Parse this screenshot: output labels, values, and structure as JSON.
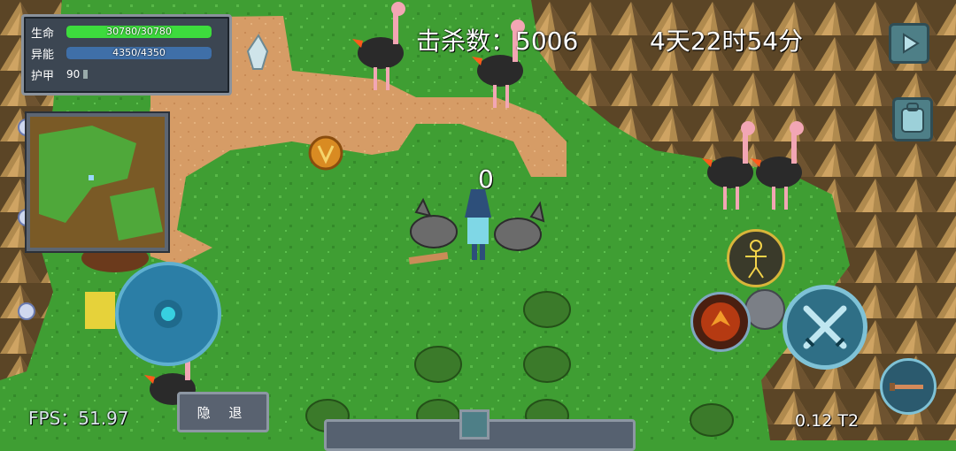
{
  "hud": {
    "stats": {
      "hp_label": "生命",
      "hp_value": "30780/30780",
      "hp_fraction": 1.0,
      "energy_label": "异能",
      "energy_value": "4350/4350",
      "energy_fraction": 1.0,
      "armor_label": "护甲",
      "armor_value": "90"
    },
    "kills": "击杀数：5006",
    "time": "4天22时54分",
    "fps": "FPS：51.97",
    "version": "0.12 T2",
    "hide_button": "隐 退",
    "floating_number": "0"
  },
  "icons": {
    "play": "play-icon",
    "backpack": "backpack-icon",
    "character": "character-icon",
    "skill_fire": "fire-skill-icon",
    "attack": "crossed-swords-icon",
    "weapon": "weapon-icon",
    "joystick": "joystick-icon"
  },
  "colors": {
    "hp": "#3ddc3d",
    "energy": "#3f6fa8",
    "grass": "#3f9e33",
    "path": "#d9a46f",
    "mountain": "#8a6a3a"
  }
}
